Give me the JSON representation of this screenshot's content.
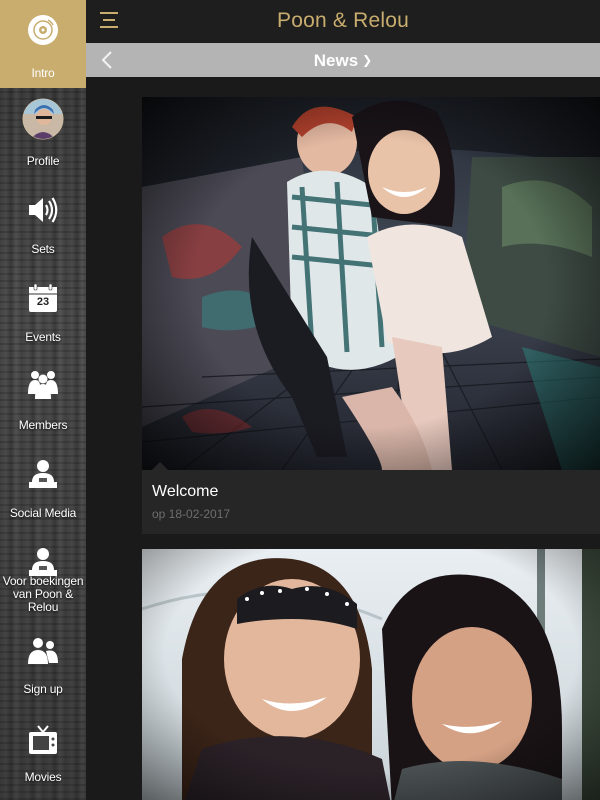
{
  "app": {
    "title": "Poon & Relou"
  },
  "subheader": {
    "title": "News"
  },
  "sidebar": {
    "items": [
      {
        "label": "Intro",
        "icon": "vinyl-disc-icon",
        "active": true
      },
      {
        "label": "Profile",
        "icon": "profile-avatar"
      },
      {
        "label": "Sets",
        "icon": "speaker-icon"
      },
      {
        "label": "Events",
        "icon": "calendar-icon",
        "calendar_day": "23"
      },
      {
        "label": "Members",
        "icon": "members-icon"
      },
      {
        "label": "Social Media",
        "icon": "person-laptop-icon"
      },
      {
        "label": "Voor boekingen van Poon & Relou",
        "icon": "person-laptop-icon"
      },
      {
        "label": "Sign up",
        "icon": "group-icon"
      },
      {
        "label": "Movies",
        "icon": "tv-icon"
      }
    ]
  },
  "news": [
    {
      "title": "Welcome",
      "date": "op 18-02-2017"
    },
    {
      "title": "",
      "date": ""
    }
  ],
  "colors": {
    "accent": "#c8ad6e",
    "subbar": "#b4b4b4",
    "topbar": "#1e1e1e",
    "card": "#262626"
  }
}
